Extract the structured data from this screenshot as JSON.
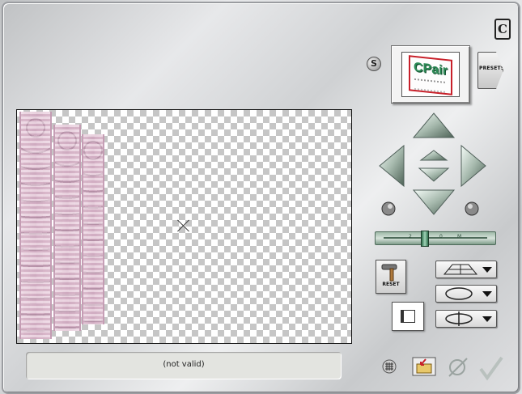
{
  "window": {
    "logo": "C",
    "status_text": "(not valid)"
  },
  "preview": {
    "thumb_label": "CPair",
    "badge_label": "S"
  },
  "buttons": {
    "presets_label": "PRESETS",
    "reset_label": "RESET"
  },
  "slider": {
    "ticks": [
      "2",
      "0",
      "M"
    ],
    "value": 0.45
  },
  "colors": {
    "pattern_pink": "#e6c3d7",
    "accent_green": "#2e8b57",
    "thumb_border_red": "#c8202a"
  },
  "icons": [
    "arrow-up-icon",
    "arrow-down-icon",
    "arrow-left-icon",
    "arrow-right-icon",
    "center-up-icon",
    "center-down-icon",
    "rotate-left-knob-icon",
    "rotate-right-knob-icon",
    "grid-icon",
    "folder-icon",
    "cancel-icon",
    "ok-checkmark-icon",
    "perspective-grid-icon",
    "rotation-circle-icon",
    "flip-icon",
    "hammer-icon"
  ]
}
